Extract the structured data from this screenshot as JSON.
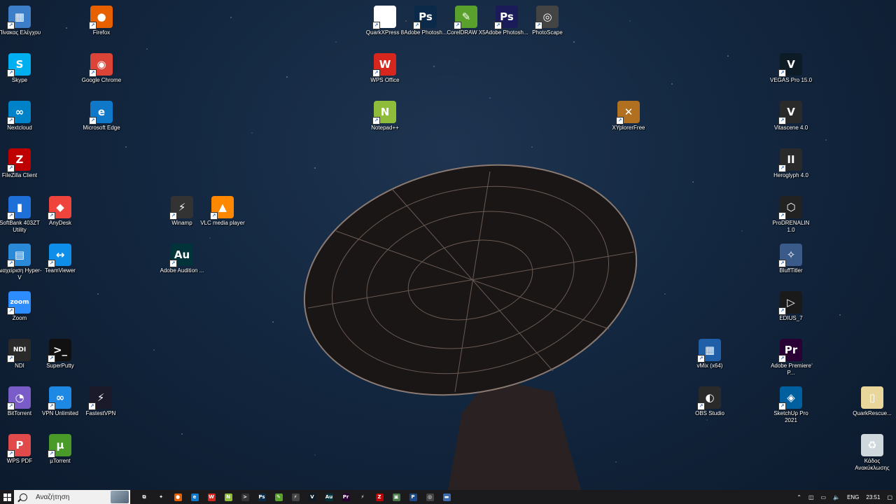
{
  "desktop": {
    "icons": [
      {
        "id": "control-panel",
        "label": "Πίνακας Ελέγχου",
        "glyph": "▦",
        "color": "#3c7fc8"
      },
      {
        "id": "firefox",
        "label": "Firefox",
        "glyph": "●",
        "color": "#e66000"
      },
      {
        "id": "quarkxpress",
        "label": "QuarkXPress 8",
        "glyph": "✦",
        "color": "#ffffff"
      },
      {
        "id": "photoshop-1",
        "label": "Adobe Photosh...",
        "glyph": "Ps",
        "color": "#0b2a4a"
      },
      {
        "id": "coreldraw",
        "label": "CorelDRAW X5",
        "glyph": "✎",
        "color": "#5aa02c"
      },
      {
        "id": "photoshop-2",
        "label": "Adobe Photosh...",
        "glyph": "Ps",
        "color": "#1b1b5a"
      },
      {
        "id": "photoscape",
        "label": "PhotoScape",
        "glyph": "◎",
        "color": "#444444"
      },
      {
        "id": "skype",
        "label": "Skype",
        "glyph": "S",
        "color": "#00aff0"
      },
      {
        "id": "chrome",
        "label": "Google Chrome",
        "glyph": "◉",
        "color": "#db4437"
      },
      {
        "id": "wps-office",
        "label": "WPS Office",
        "glyph": "W",
        "color": "#d7261e"
      },
      {
        "id": "vegas",
        "label": "VEGAS Pro 15.0",
        "glyph": "V",
        "color": "#0d1b26"
      },
      {
        "id": "nextcloud",
        "label": "Nextcloud",
        "glyph": "∞",
        "color": "#0082c9"
      },
      {
        "id": "edge",
        "label": "Microsoft Edge",
        "glyph": "e",
        "color": "#0f78c8"
      },
      {
        "id": "notepadpp",
        "label": "Notepad++",
        "glyph": "N",
        "color": "#8fbc3a"
      },
      {
        "id": "xyplorer",
        "label": "XYplorerFree",
        "glyph": "✕",
        "color": "#b07020"
      },
      {
        "id": "vitascene",
        "label": "Vitascene 4.0",
        "glyph": "V",
        "color": "#2a2a2a"
      },
      {
        "id": "filezilla",
        "label": "FileZilla Client",
        "glyph": "Z",
        "color": "#bf0000"
      },
      {
        "id": "heroglyph",
        "label": "Heroglyph 4.0",
        "glyph": "II",
        "color": "#2a2a2a"
      },
      {
        "id": "softbank",
        "label": "SoftBank 403ZT Utility",
        "glyph": "▮",
        "color": "#1e6fd8"
      },
      {
        "id": "anydesk",
        "label": "AnyDesk",
        "glyph": "◆",
        "color": "#ef443b"
      },
      {
        "id": "winamp",
        "label": "Winamp",
        "glyph": "⚡",
        "color": "#333333"
      },
      {
        "id": "vlc",
        "label": "VLC media player",
        "glyph": "▲",
        "color": "#ff8800"
      },
      {
        "id": "prodrenalin",
        "label": "ProDRENALIN 1.0",
        "glyph": "⬡",
        "color": "#222222"
      },
      {
        "id": "hyperv",
        "label": "Διαχείριση Hyper-V",
        "glyph": "▤",
        "color": "#2a8ad8"
      },
      {
        "id": "teamviewer",
        "label": "TeamViewer",
        "glyph": "↔",
        "color": "#0e8ee9"
      },
      {
        "id": "audition",
        "label": "Adobe Audition ...",
        "glyph": "Au",
        "color": "#00343a"
      },
      {
        "id": "blufftitler",
        "label": "BluffTitler",
        "glyph": "✧",
        "color": "#3a5a8a"
      },
      {
        "id": "zoom",
        "label": "Zoom",
        "glyph": "zoom",
        "color": "#2d8cff"
      },
      {
        "id": "edius",
        "label": "EDIUS_7",
        "glyph": "▷",
        "color": "#1a1a1a"
      },
      {
        "id": "ndi",
        "label": "NDI",
        "glyph": "NDI",
        "color": "#2a2a2a"
      },
      {
        "id": "superputty",
        "label": "SuperPutty",
        "glyph": ">_",
        "color": "#111111"
      },
      {
        "id": "vmix",
        "label": "vMix (x64)",
        "glyph": "▦",
        "color": "#1f5fa8"
      },
      {
        "id": "premiere",
        "label": "Adobe Premiere P...",
        "glyph": "Pr",
        "color": "#2a0034"
      },
      {
        "id": "bittorrent",
        "label": "BitTorrent",
        "glyph": "◔",
        "color": "#7a5cc8"
      },
      {
        "id": "vpn-unlimited",
        "label": "VPN Unlimited",
        "glyph": "∞",
        "color": "#1e88e5"
      },
      {
        "id": "fastestvpn",
        "label": "FastestVPN",
        "glyph": "⚡",
        "color": "#1a1a2a"
      },
      {
        "id": "obs",
        "label": "OBS Studio",
        "glyph": "◐",
        "color": "#2a2a2a"
      },
      {
        "id": "sketchup",
        "label": "SketchUp Pro 2021",
        "glyph": "◈",
        "color": "#005f9e"
      },
      {
        "id": "quarkrescue",
        "label": "QuarkRescue...",
        "glyph": "▯",
        "color": "#e8d69a"
      },
      {
        "id": "wps-pdf",
        "label": "WPS PDF",
        "glyph": "P",
        "color": "#e04a4a"
      },
      {
        "id": "utorrent",
        "label": "µTorrent",
        "glyph": "µ",
        "color": "#4a9a2a"
      },
      {
        "id": "recycle-bin",
        "label": "Κάδος Ανακύκλωσης",
        "glyph": "♻",
        "color": "#cfd8dc"
      }
    ]
  },
  "taskbar": {
    "search_placeholder": "Αναζήτηση",
    "pinned": [
      {
        "id": "task-view",
        "glyph": "⧉",
        "color": "#1b1b1d"
      },
      {
        "id": "quarkxpress",
        "glyph": "✦",
        "color": "#1b1b1d"
      },
      {
        "id": "firefox",
        "glyph": "●",
        "color": "#e66000"
      },
      {
        "id": "edge",
        "glyph": "e",
        "color": "#0f78c8"
      },
      {
        "id": "wps-office",
        "glyph": "W",
        "color": "#d7261e"
      },
      {
        "id": "notepadpp",
        "glyph": "N",
        "color": "#8fbc3a"
      },
      {
        "id": "superputty",
        "glyph": ">",
        "color": "#333333"
      },
      {
        "id": "photoshop",
        "glyph": "Ps",
        "color": "#0b2a4a"
      },
      {
        "id": "coreldraw",
        "glyph": "✎",
        "color": "#5aa02c"
      },
      {
        "id": "winamp",
        "glyph": "⚡",
        "color": "#444444"
      },
      {
        "id": "vegas",
        "glyph": "V",
        "color": "#0d1b26"
      },
      {
        "id": "audition",
        "glyph": "Au",
        "color": "#00343a"
      },
      {
        "id": "premiere",
        "glyph": "Pr",
        "color": "#2a0034"
      },
      {
        "id": "fastestvpn",
        "glyph": "⚡",
        "color": "#1b1b1d"
      },
      {
        "id": "filezilla",
        "glyph": "Z",
        "color": "#bf0000"
      },
      {
        "id": "app-1",
        "glyph": "▣",
        "color": "#4a7a4a"
      },
      {
        "id": "app-2",
        "glyph": "P",
        "color": "#1a4a8a"
      },
      {
        "id": "photoscape",
        "glyph": "◎",
        "color": "#444444"
      },
      {
        "id": "app-3",
        "glyph": "▬",
        "color": "#3a6aaa"
      }
    ],
    "tray": {
      "language": "ENG",
      "time": "23:51"
    }
  }
}
